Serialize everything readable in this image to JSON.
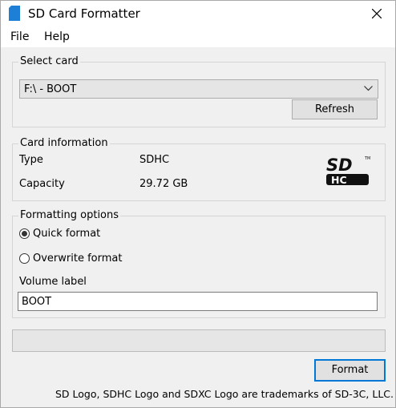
{
  "window": {
    "title": "SD Card Formatter"
  },
  "menu": {
    "file": "File",
    "help": "Help"
  },
  "select_card": {
    "group_label": "Select card",
    "selected": "F:\\ - BOOT",
    "refresh_label": "Refresh"
  },
  "card_info": {
    "group_label": "Card information",
    "type_key": "Type",
    "type_value": "SDHC",
    "capacity_key": "Capacity",
    "capacity_value": "29.72 GB",
    "logo_top": "SD",
    "logo_bottom": "HC",
    "logo_tm": "TM"
  },
  "formatting": {
    "group_label": "Formatting options",
    "quick_label": "Quick format",
    "quick_checked": true,
    "overwrite_label": "Overwrite format",
    "overwrite_checked": false,
    "volume_label_title": "Volume label",
    "volume_label_value": "BOOT"
  },
  "progress": {
    "value": 0
  },
  "footer": {
    "format_label": "Format",
    "trademark": "SD Logo, SDHC Logo and SDXC Logo are trademarks of SD-3C, LLC."
  }
}
